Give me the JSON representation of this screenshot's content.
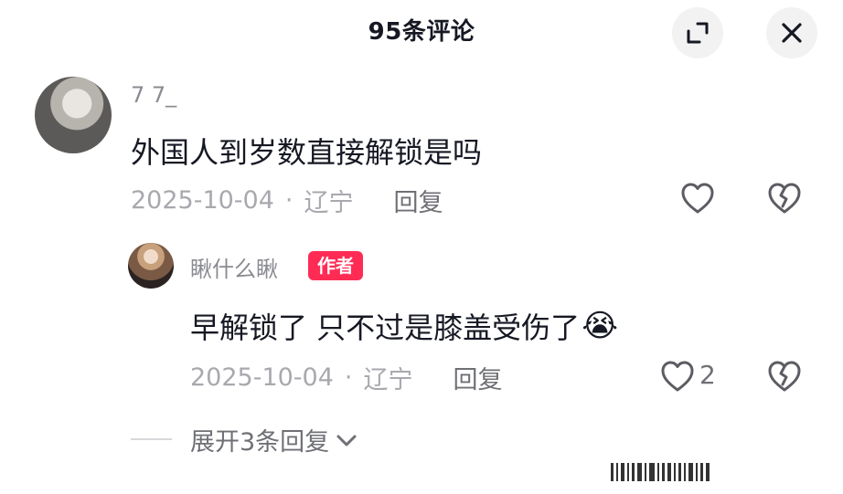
{
  "header": {
    "title": "95条评论"
  },
  "comment": {
    "username": "7 7_",
    "text": "外国人到岁数直接解锁是吗",
    "date": "2025-10-04",
    "separator": "·",
    "location": "辽宁",
    "reply_label": "回复"
  },
  "reply": {
    "username": "瞅什么瞅",
    "author_badge": "作者",
    "text": "早解锁了 只不过是膝盖受伤了",
    "emoji": "😭",
    "date": "2025-10-04",
    "separator": "·",
    "location": "辽宁",
    "reply_label": "回复",
    "like_count": "2"
  },
  "expand": {
    "label": "展开3条回复"
  },
  "colors": {
    "accent": "#fe2c55",
    "text_primary": "#161823",
    "text_secondary": "#a8a9ae"
  }
}
